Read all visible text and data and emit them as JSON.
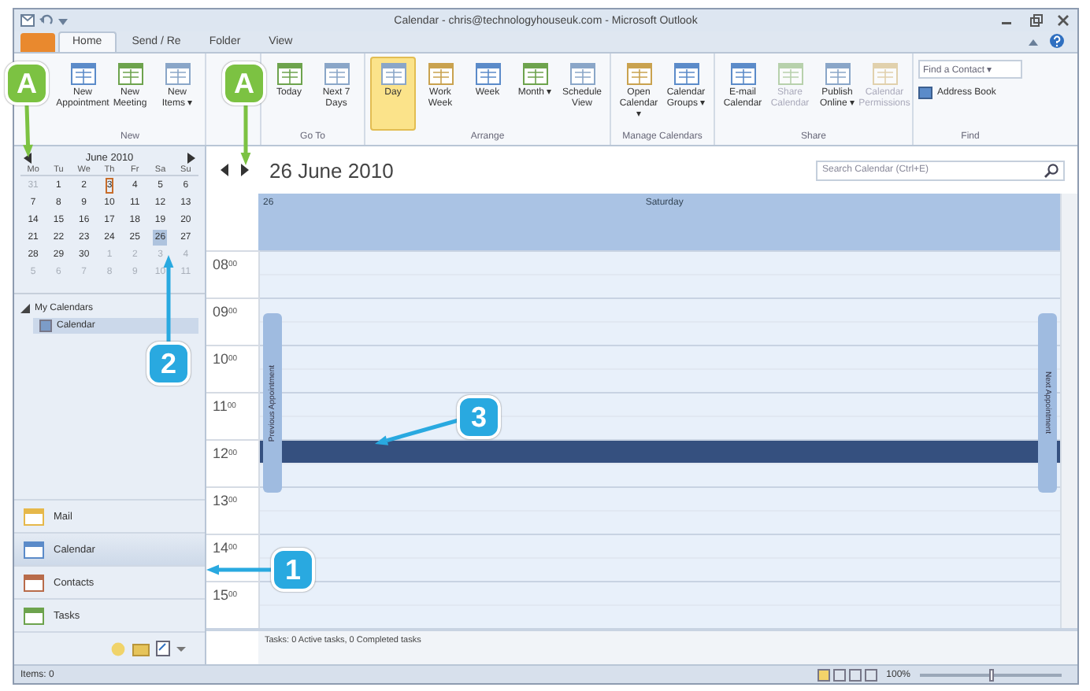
{
  "window": {
    "title": "Calendar - chris@technologyhouseuk.com - Microsoft Outlook"
  },
  "ribbon": {
    "tabs": [
      {
        "label": "Home",
        "selected": true
      },
      {
        "label": "Send / Re",
        "selected": false
      },
      {
        "label": "Folder",
        "selected": false
      },
      {
        "label": "View",
        "selected": false
      }
    ],
    "groups": [
      {
        "label": "New",
        "buttons": [
          {
            "label": "New Appointment",
            "selected": false,
            "disabled": false
          },
          {
            "label": "New Meeting",
            "selected": false,
            "disabled": false
          },
          {
            "label": "New Items ▾",
            "selected": false,
            "disabled": false
          }
        ]
      },
      {
        "label": "Go To",
        "buttons": [
          {
            "label": "Today",
            "selected": false,
            "disabled": false
          },
          {
            "label": "Next 7 Days",
            "selected": false,
            "disabled": false
          }
        ]
      },
      {
        "label": "Arrange",
        "buttons": [
          {
            "label": "Day",
            "selected": true,
            "disabled": false
          },
          {
            "label": "Work Week",
            "selected": false,
            "disabled": false
          },
          {
            "label": "Week",
            "selected": false,
            "disabled": false
          },
          {
            "label": "Month ▾",
            "selected": false,
            "disabled": false
          },
          {
            "label": "Schedule View",
            "selected": false,
            "disabled": false
          }
        ]
      },
      {
        "label": "Manage Calendars",
        "buttons": [
          {
            "label": "Open Calendar ▾",
            "selected": false,
            "disabled": false
          },
          {
            "label": "Calendar Groups ▾",
            "selected": false,
            "disabled": false
          }
        ]
      },
      {
        "label": "Share",
        "buttons": [
          {
            "label": "E-mail Calendar",
            "selected": false,
            "disabled": false
          },
          {
            "label": "Share Calendar",
            "selected": false,
            "disabled": true
          },
          {
            "label": "Publish Online ▾",
            "selected": false,
            "disabled": false
          },
          {
            "label": "Calendar Permissions",
            "selected": false,
            "disabled": true
          }
        ]
      }
    ],
    "find": {
      "label": "Find",
      "contact_placeholder": "Find a Contact ▾",
      "address_book": "Address Book"
    }
  },
  "date_navigator": {
    "month": "June 2010",
    "weekdays": [
      "Mo",
      "Tu",
      "We",
      "Th",
      "Fr",
      "Sa",
      "Su"
    ],
    "weeks": [
      [
        {
          "day": "31",
          "other": true,
          "today": false,
          "selected": false
        },
        {
          "day": "1",
          "other": false,
          "today": false,
          "selected": false
        },
        {
          "day": "2",
          "other": false,
          "today": false,
          "selected": false
        },
        {
          "day": "3",
          "other": false,
          "today": true,
          "selected": false
        },
        {
          "day": "4",
          "other": false,
          "today": false,
          "selected": false
        },
        {
          "day": "5",
          "other": false,
          "today": false,
          "selected": false
        },
        {
          "day": "6",
          "other": false,
          "today": false,
          "selected": false
        }
      ],
      [
        {
          "day": "7",
          "other": false,
          "today": false,
          "selected": false
        },
        {
          "day": "8",
          "other": false,
          "today": false,
          "selected": false
        },
        {
          "day": "9",
          "other": false,
          "today": false,
          "selected": false
        },
        {
          "day": "10",
          "other": false,
          "today": false,
          "selected": false
        },
        {
          "day": "11",
          "other": false,
          "today": false,
          "selected": false
        },
        {
          "day": "12",
          "other": false,
          "today": false,
          "selected": false
        },
        {
          "day": "13",
          "other": false,
          "today": false,
          "selected": false
        }
      ],
      [
        {
          "day": "14",
          "other": false,
          "today": false,
          "selected": false
        },
        {
          "day": "15",
          "other": false,
          "today": false,
          "selected": false
        },
        {
          "day": "16",
          "other": false,
          "today": false,
          "selected": false
        },
        {
          "day": "17",
          "other": false,
          "today": false,
          "selected": false
        },
        {
          "day": "18",
          "other": false,
          "today": false,
          "selected": false
        },
        {
          "day": "19",
          "other": false,
          "today": false,
          "selected": false
        },
        {
          "day": "20",
          "other": false,
          "today": false,
          "selected": false
        }
      ],
      [
        {
          "day": "21",
          "other": false,
          "today": false,
          "selected": false
        },
        {
          "day": "22",
          "other": false,
          "today": false,
          "selected": false
        },
        {
          "day": "23",
          "other": false,
          "today": false,
          "selected": false
        },
        {
          "day": "24",
          "other": false,
          "today": false,
          "selected": false
        },
        {
          "day": "25",
          "other": false,
          "today": false,
          "selected": false
        },
        {
          "day": "26",
          "other": false,
          "today": false,
          "selected": true
        },
        {
          "day": "27",
          "other": false,
          "today": false,
          "selected": false
        }
      ],
      [
        {
          "day": "28",
          "other": false,
          "today": false,
          "selected": false
        },
        {
          "day": "29",
          "other": false,
          "today": false,
          "selected": false
        },
        {
          "day": "30",
          "other": false,
          "today": false,
          "selected": false
        },
        {
          "day": "1",
          "other": true,
          "today": false,
          "selected": false
        },
        {
          "day": "2",
          "other": true,
          "today": false,
          "selected": false
        },
        {
          "day": "3",
          "other": true,
          "today": false,
          "selected": false
        },
        {
          "day": "4",
          "other": true,
          "today": false,
          "selected": false
        }
      ],
      [
        {
          "day": "5",
          "other": true,
          "today": false,
          "selected": false
        },
        {
          "day": "6",
          "other": true,
          "today": false,
          "selected": false
        },
        {
          "day": "7",
          "other": true,
          "today": false,
          "selected": false
        },
        {
          "day": "8",
          "other": true,
          "today": false,
          "selected": false
        },
        {
          "day": "9",
          "other": true,
          "today": false,
          "selected": false
        },
        {
          "day": "10",
          "other": true,
          "today": false,
          "selected": false
        },
        {
          "day": "11",
          "other": true,
          "today": false,
          "selected": false
        }
      ]
    ]
  },
  "my_calendars": {
    "label": "My Calendars",
    "expanded": true,
    "items": [
      {
        "label": "Calendar",
        "selected": true
      }
    ]
  },
  "navigation": [
    {
      "label": "Mail",
      "selected": false
    },
    {
      "label": "Calendar",
      "selected": true
    },
    {
      "label": "Contacts",
      "selected": false
    },
    {
      "label": "Tasks",
      "selected": false
    }
  ],
  "calendar": {
    "date_title": "26 June 2010",
    "search": {
      "placeholder": "Search Calendar (Ctrl+E)"
    },
    "day_number": "26",
    "weekday": "Saturday",
    "previous_appointment": "Previous Appointment",
    "next_appointment": "Next Appointment",
    "hours": [
      {
        "hour": "08",
        "minutes": "00",
        "slots": [
          {
            "selected": false
          },
          {
            "selected": false
          }
        ]
      },
      {
        "hour": "09",
        "minutes": "00",
        "slots": [
          {
            "selected": false
          },
          {
            "selected": false
          }
        ]
      },
      {
        "hour": "10",
        "minutes": "00",
        "slots": [
          {
            "selected": false
          },
          {
            "selected": false
          }
        ]
      },
      {
        "hour": "11",
        "minutes": "00",
        "slots": [
          {
            "selected": false
          },
          {
            "selected": false
          }
        ]
      },
      {
        "hour": "12",
        "minutes": "00",
        "slots": [
          {
            "selected": true
          },
          {
            "selected": false
          }
        ]
      },
      {
        "hour": "13",
        "minutes": "00",
        "slots": [
          {
            "selected": false
          },
          {
            "selected": false
          }
        ]
      },
      {
        "hour": "14",
        "minutes": "00",
        "slots": [
          {
            "selected": false
          },
          {
            "selected": false
          }
        ]
      },
      {
        "hour": "15",
        "minutes": "00",
        "slots": [
          {
            "selected": false
          },
          {
            "selected": false
          }
        ]
      }
    ],
    "tasks_bar": "Tasks: 0 Active tasks, 0 Completed tasks"
  },
  "status_bar": {
    "items": "Items: 0",
    "zoom": {
      "reading": "100%",
      "level": 0.5
    }
  },
  "callouts": [
    {
      "label": "A",
      "color": "#7cc242"
    },
    {
      "label": "A",
      "color": "#7cc242"
    },
    {
      "label": "2",
      "color": "#29a9e0"
    },
    {
      "label": "3",
      "color": "#29a9e0"
    },
    {
      "label": "1",
      "color": "#29a9e0"
    }
  ]
}
